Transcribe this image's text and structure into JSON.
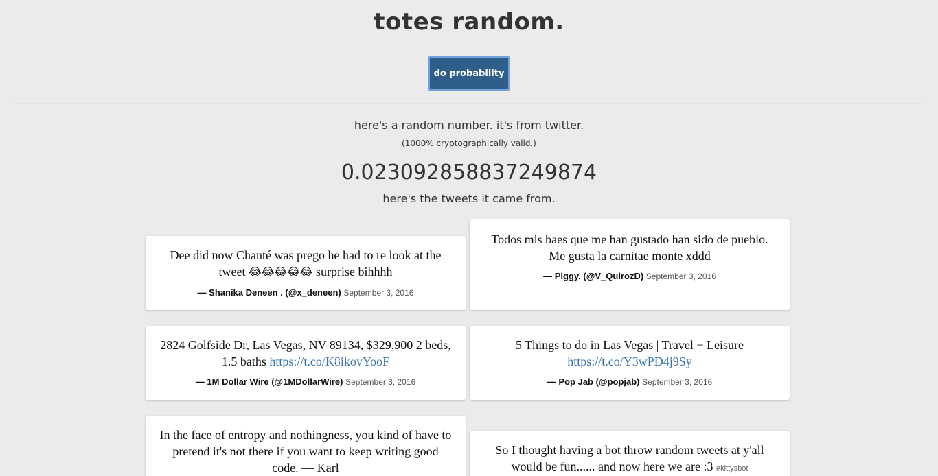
{
  "header": {
    "title": "totes random.",
    "button_label": "do probability"
  },
  "intro": {
    "line1": "here's a random number. it's from twitter.",
    "line2": "(1000% cryptographically valid.)",
    "number": "0.023092858837249874",
    "line3": "here's the tweets it came from."
  },
  "tweets": [
    {
      "text_before": "Dee did now Chanté was prego he had to re look at the tweet ",
      "emoji": "😂😂😂😂😂",
      "text_after": " surprise bihhhh",
      "author": "— Shanika Deneen . (@x_deneen)",
      "date": "September 3, 2016"
    },
    {
      "text": "Todos mis baes que me han gustado han sido de pueblo.\nMe gusta la carnitae monte xddd",
      "author": "— Piggy. (@V_QuirozD)",
      "date": "September 3, 2016"
    },
    {
      "text": "2824 Golfside Dr, Las Vegas, NV 89134, $329,900 2 beds, 1.5 baths ",
      "link": "https://t.co/K8ikovYooF",
      "author": "— 1M Dollar Wire (@1MDollarWire)",
      "date": "September 3, 2016"
    },
    {
      "text": "5 Things to do in Las Vegas | Travel + Leisure ",
      "link": "https://t.co/Y3wPD4j9Sy",
      "author": "— Pop Jab (@popjab)",
      "date": "September 3, 2016"
    },
    {
      "text": "In the face of entropy and nothingness, you kind of have to pretend it's not there if you want to keep writing good code. — Karl"
    },
    {
      "text": "So I thought having a bot throw random tweets at y'all would be fun...... and now here we are :3 ",
      "hashtag": "#kittysbot"
    }
  ]
}
